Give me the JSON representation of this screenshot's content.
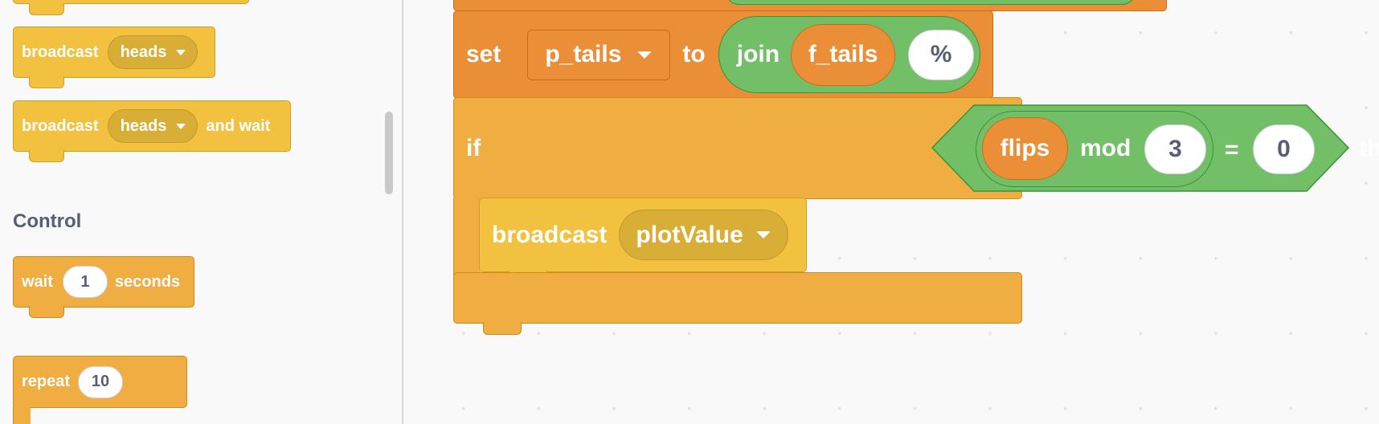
{
  "palette": {
    "blocks": {
      "broadcast": {
        "label": "broadcast",
        "message": "heads"
      },
      "broadcast_wait": {
        "label": "broadcast",
        "message": "heads",
        "suffix": "and wait"
      }
    },
    "section_title": "Control",
    "wait": {
      "label": "wait",
      "value": "1",
      "suffix": "seconds"
    },
    "repeat": {
      "label": "repeat",
      "value": "10"
    }
  },
  "script": {
    "set": {
      "label": "set",
      "variable": "p_tails",
      "to": "to",
      "join": "join",
      "join_first": "f_tails",
      "join_second": "%"
    },
    "if": {
      "label": "if",
      "reporter": "flips",
      "mod": "mod",
      "mod_value": "3",
      "equals": "=",
      "equals_value": "0",
      "then": "then"
    },
    "broadcast": {
      "label": "broadcast",
      "message": "plotValue"
    }
  },
  "colors": {
    "events": "#f2c13f",
    "control": "#f0ad42",
    "variables": "#eb8e38",
    "operators": "#72bf67",
    "background": "#f9f9f9"
  }
}
